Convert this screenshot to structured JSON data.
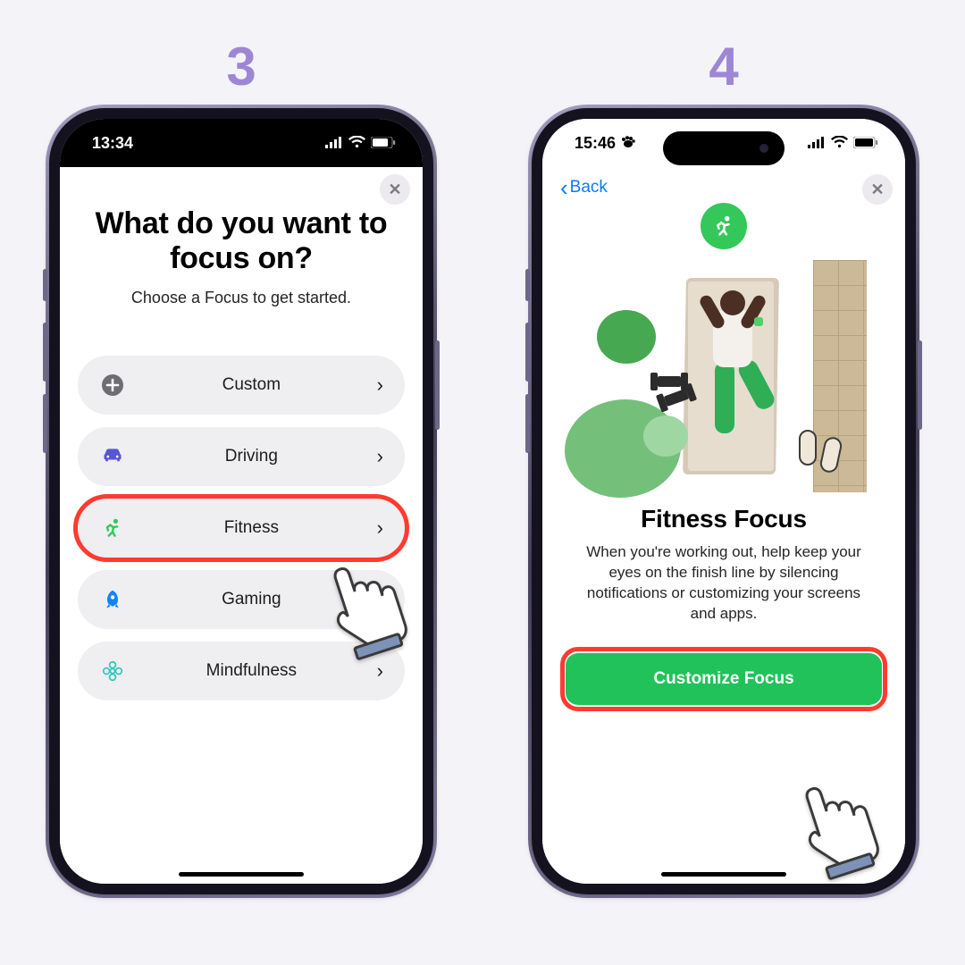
{
  "steps": {
    "left": "3",
    "right": "4"
  },
  "status": {
    "left_time": "13:34",
    "right_time": "15:46"
  },
  "screen3": {
    "title_l1": "What do you want to",
    "title_l2": "focus on?",
    "subtitle": "Choose a Focus to get started.",
    "items": [
      {
        "label": "Custom",
        "icon": "plus",
        "color": "#6e6d73"
      },
      {
        "label": "Driving",
        "icon": "car",
        "color": "#5856d6"
      },
      {
        "label": "Fitness",
        "icon": "runner",
        "color": "#34c759"
      },
      {
        "label": "Gaming",
        "icon": "rocket",
        "color": "#0b84ff"
      },
      {
        "label": "Mindfulness",
        "icon": "flower",
        "color": "#2fc8bb"
      }
    ],
    "highlight_index": 2
  },
  "screen4": {
    "back_label": "Back",
    "title": "Fitness Focus",
    "description": "When you're working out, help keep your eyes on the finish line by silencing notifications or customizing your screens and apps.",
    "cta": "Customize Focus"
  }
}
